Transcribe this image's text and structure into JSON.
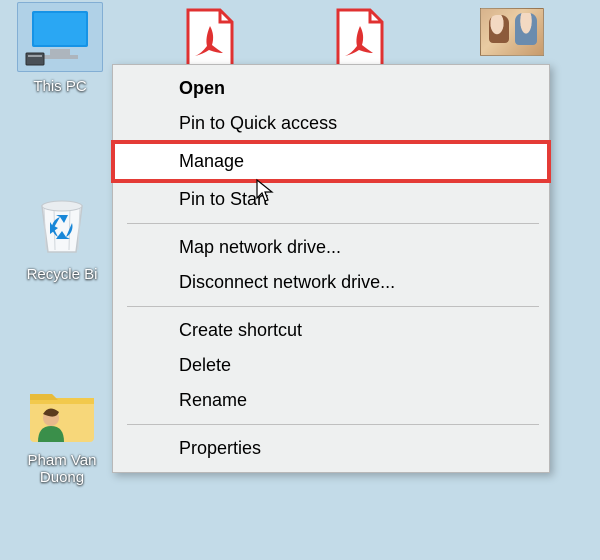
{
  "desktop": {
    "thispc_label": "This PC",
    "recycle_label": "Recycle Bi",
    "folder_label_line1": "Pham Van",
    "folder_label_line2": "Duong"
  },
  "context_menu": {
    "open": "Open",
    "pin_quick": "Pin to Quick access",
    "manage": "Manage",
    "pin_start": "Pin to Start",
    "map_drive": "Map network drive...",
    "disconnect_drive": "Disconnect network drive...",
    "create_shortcut": "Create shortcut",
    "delete": "Delete",
    "rename": "Rename",
    "properties": "Properties"
  }
}
